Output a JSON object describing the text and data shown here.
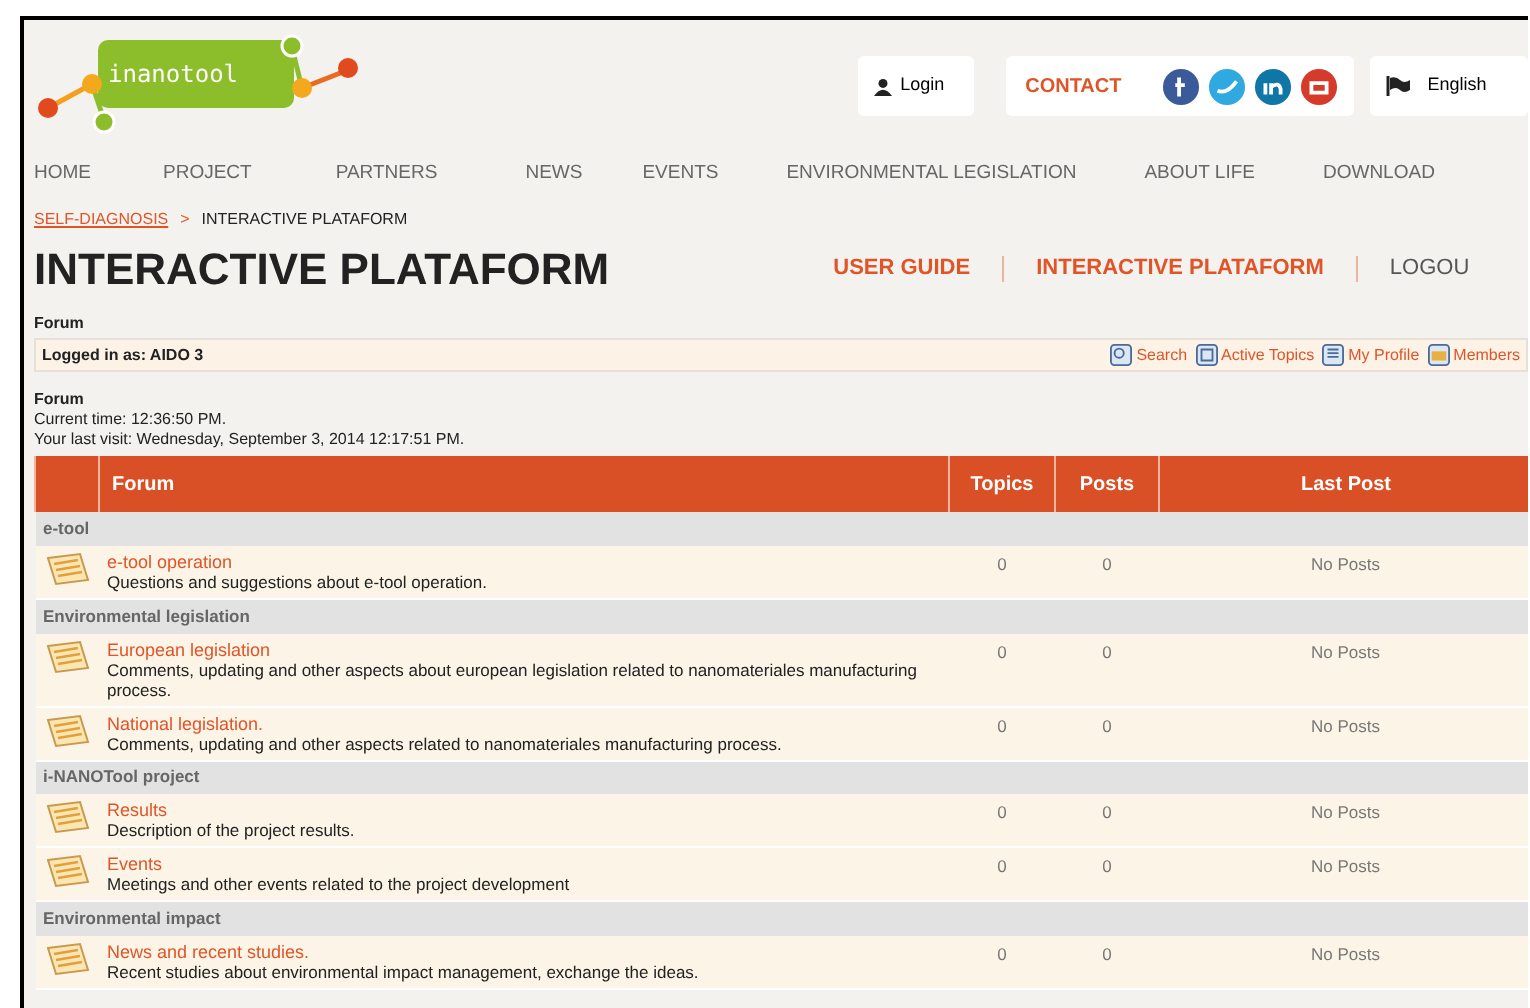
{
  "header": {
    "logo": "inanotool",
    "login": "Login",
    "contact": "CONTACT",
    "language": "English"
  },
  "nav": [
    "HOME",
    "PROJECT",
    "PARTNERS",
    "NEWS",
    "EVENTS",
    "ENVIRONMENTAL LEGISLATION",
    "ABOUT LIFE",
    "DOWNLOAD"
  ],
  "breadcrumb": [
    {
      "label": "SELF-DIAGNOSIS",
      "kind": "link"
    },
    {
      "label": ">",
      "kind": "separator"
    },
    {
      "label": "INTERACTIVE PLATAFORM",
      "kind": "current"
    }
  ],
  "title": "INTERACTIVE PLATAFORM",
  "page_links": [
    {
      "label": "USER GUIDE",
      "selected": false
    },
    {
      "label": "INTERACTIVE PLATAFORM",
      "selected": false
    },
    {
      "label": "LOGOU",
      "selected": true
    }
  ],
  "forum_label": "Forum",
  "logged_in": "Logged in as: AIDO 3",
  "toolbar": [
    {
      "label": "Search",
      "kind": "search"
    },
    {
      "label": "Active Topics",
      "kind": "topics"
    },
    {
      "label": "My Profile",
      "kind": "profile"
    },
    {
      "label": "Members",
      "kind": "members"
    }
  ],
  "info": {
    "heading": "Forum",
    "current_time": "Current time: 12:36:50 PM.",
    "last_visit": "Your last visit: Wednesday, September 3, 2014 12:17:51 PM."
  },
  "table": {
    "columns": [
      "Forum",
      "Topics",
      "Posts",
      "Last Post"
    ],
    "groups": [
      {
        "name": "e-tool",
        "forums": [
          {
            "title": "e-tool operation",
            "description": "Questions and suggestions about e-tool operation.",
            "topics": "0",
            "posts": "0",
            "last_post": "No Posts"
          }
        ]
      },
      {
        "name": "Environmental legislation",
        "forums": [
          {
            "title": "European legislation",
            "description": "Comments, updating and other aspects about european legislation related to nanomateriales manufacturing process.",
            "topics": "0",
            "posts": "0",
            "last_post": "No Posts"
          },
          {
            "title": "National legislation.",
            "description": "Comments, updating and other aspects related to nanomateriales manufacturing process.",
            "topics": "0",
            "posts": "0",
            "last_post": "No Posts"
          }
        ]
      },
      {
        "name": "i-NANOTool project",
        "forums": [
          {
            "title": "Results",
            "description": "Description of the project results.",
            "topics": "0",
            "posts": "0",
            "last_post": "No Posts"
          },
          {
            "title": "Events",
            "description": "Meetings and other events related to the project development",
            "topics": "0",
            "posts": "0",
            "last_post": "No Posts"
          }
        ]
      },
      {
        "name": "Environmental impact",
        "forums": [
          {
            "title": "News and recent studies.",
            "description": "Recent studies about environmental impact management, exchange the ideas.",
            "topics": "0",
            "posts": "0",
            "last_post": "No Posts"
          }
        ]
      }
    ]
  }
}
